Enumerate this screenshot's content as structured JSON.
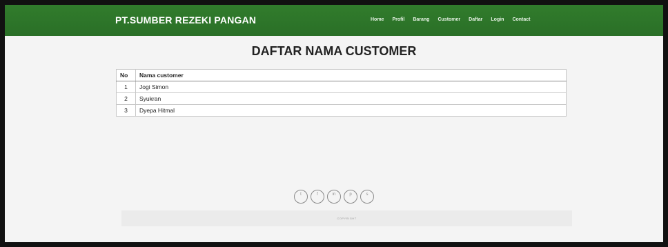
{
  "header": {
    "brand": "PT.SUMBER REZEKI PANGAN",
    "nav": [
      "Home",
      "Profil",
      "Barang",
      "Customer",
      "Daftar",
      "Login",
      "Contact"
    ],
    "accent_color": "#2e7d32"
  },
  "main": {
    "title": "DAFTAR NAMA CUSTOMER",
    "table": {
      "headers": [
        "No",
        "Nama customer"
      ],
      "rows": [
        [
          "1",
          "Jogi Simon"
        ],
        [
          "2",
          "Syukran"
        ],
        [
          "3",
          "Dyepa Hitmal"
        ]
      ]
    }
  },
  "footer": {
    "social_icons": [
      {
        "name": "twitter-icon",
        "glyph": "t"
      },
      {
        "name": "facebook-icon",
        "glyph": "f"
      },
      {
        "name": "linkedin-icon",
        "glyph": "in"
      },
      {
        "name": "pinterest-icon",
        "glyph": "p"
      },
      {
        "name": "skype-icon",
        "glyph": "s"
      }
    ],
    "copyright": "COPYRIGHT"
  }
}
